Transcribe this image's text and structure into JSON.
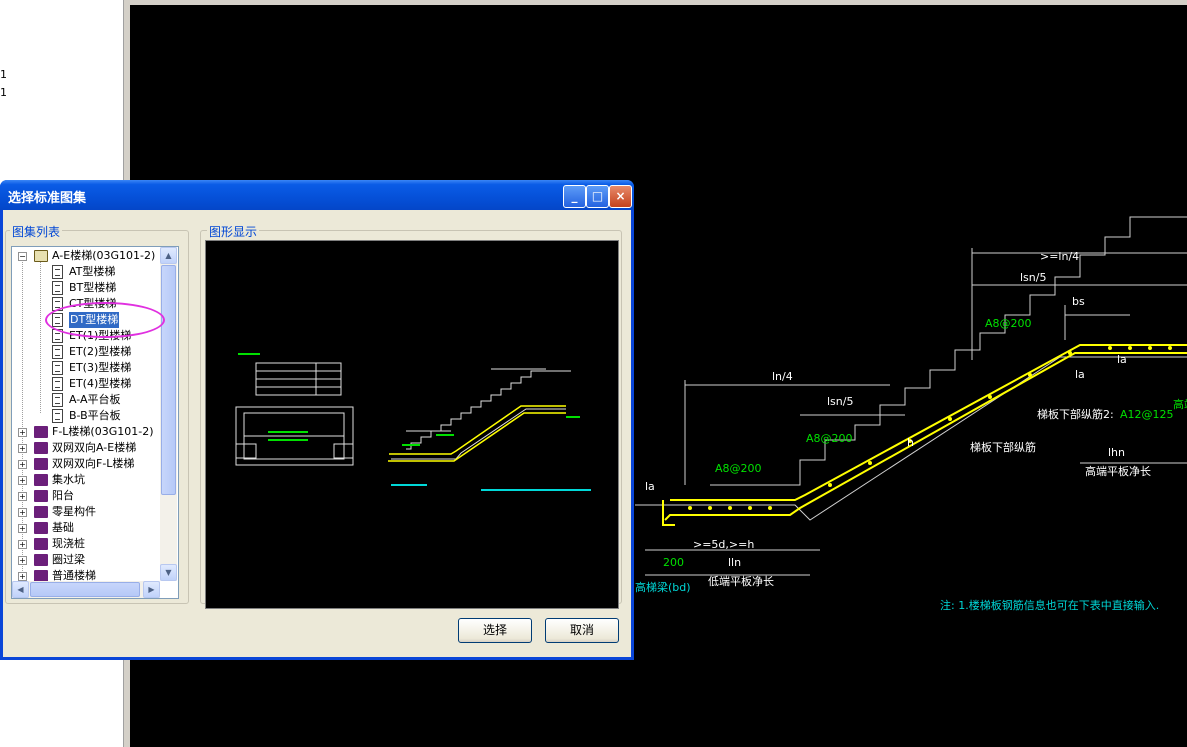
{
  "left_panel": {
    "items": [
      "1",
      "1"
    ]
  },
  "dialog": {
    "title": "选择标准图集",
    "group_list_title": "图集列表",
    "group_preview_title": "图形显示",
    "select_button": "选择",
    "cancel_button": "取消",
    "minimize_glyph": "_",
    "maximize_glyph": "□",
    "close_glyph": "×"
  },
  "tree": {
    "root": "A-E楼梯(03G101-2)",
    "children": [
      "AT型楼梯",
      "BT型楼梯",
      "CT型楼梯",
      "DT型楼梯",
      "ET(1)型楼梯",
      "ET(2)型楼梯",
      "ET(3)型楼梯",
      "ET(4)型楼梯",
      "A-A平台板",
      "B-B平台板"
    ],
    "selected": "DT型楼梯",
    "groups": [
      "F-L楼梯(03G101-2)",
      "双网双向A-E楼梯",
      "双网双向F-L楼梯",
      "集水坑",
      "阳台",
      "零星构件",
      "基础",
      "现浇桩",
      "圈过梁",
      "普通楼梯"
    ]
  },
  "cad": {
    "dim_ln4_top": ">=ln/4",
    "dim_lsn5_top": "lsn/5",
    "dim_bs": "bs",
    "label_a8200_top": "A8@200",
    "dim_ln4": "ln/4",
    "dim_lsn5": "lsn/5",
    "label_a8200_mid": "A8@200",
    "label_a8200_low": "A8@200",
    "dim_la_low": "la",
    "dim_la_high": "la",
    "dim_la_high2": "la",
    "dim_h": "h",
    "dim_5d": ">=5d,>=h",
    "dim_200": "200",
    "dim_lln": "lln",
    "label_low_plate": "低端平板净长",
    "label_low_beam": "高梯梁(bd)",
    "label_bottom_rebar2": "梯板下部纵筋2:",
    "label_a12125": "A12@125",
    "label_bottom_rebar": "梯板下部纵筋",
    "dim_lhn": "lhn",
    "label_high_plate": "高端平板净长",
    "label_high_edge": "高端",
    "note": "注: 1.楼梯板钢筋信息也可在下表中直接输入."
  },
  "colors": {
    "canvas_bg": "#000000",
    "rebar": "#ffff00",
    "green": "#00e000",
    "cyan": "#00d8d8"
  }
}
